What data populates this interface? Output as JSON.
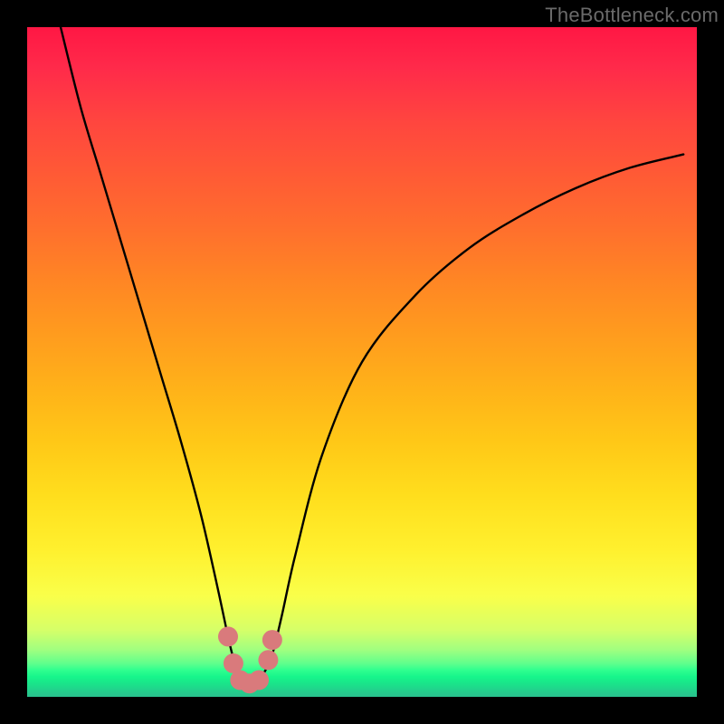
{
  "watermark": "TheBottleneck.com",
  "chart_data": {
    "type": "line",
    "title": "",
    "xlabel": "",
    "ylabel": "",
    "xlim": [
      0,
      100
    ],
    "ylim": [
      0,
      100
    ],
    "series": [
      {
        "name": "bottleneck-curve",
        "x": [
          5,
          8,
          11,
          14,
          17,
          20,
          23,
          26,
          28.5,
          30,
          31,
          32,
          33,
          34,
          35,
          36.5,
          38,
          40,
          44,
          50,
          58,
          66,
          74,
          82,
          90,
          98
        ],
        "values": [
          100,
          88,
          78,
          68,
          58,
          48,
          38,
          27,
          16,
          9,
          5,
          3,
          2,
          2,
          3,
          6,
          12,
          21,
          36,
          50,
          60,
          67,
          72,
          76,
          79,
          81
        ]
      }
    ],
    "markers": [
      {
        "name": "marker-left-top",
        "x": 30.0,
        "y": 9.0
      },
      {
        "name": "marker-left-mid",
        "x": 30.8,
        "y": 5.0
      },
      {
        "name": "marker-bottom-l",
        "x": 31.8,
        "y": 2.5
      },
      {
        "name": "marker-bottom-c",
        "x": 33.2,
        "y": 2.0
      },
      {
        "name": "marker-bottom-r",
        "x": 34.6,
        "y": 2.5
      },
      {
        "name": "marker-right-mid",
        "x": 36.0,
        "y": 5.5
      },
      {
        "name": "marker-right-top",
        "x": 36.6,
        "y": 8.5
      }
    ],
    "marker_color": "#d97a7c",
    "curve_color": "#000000"
  }
}
